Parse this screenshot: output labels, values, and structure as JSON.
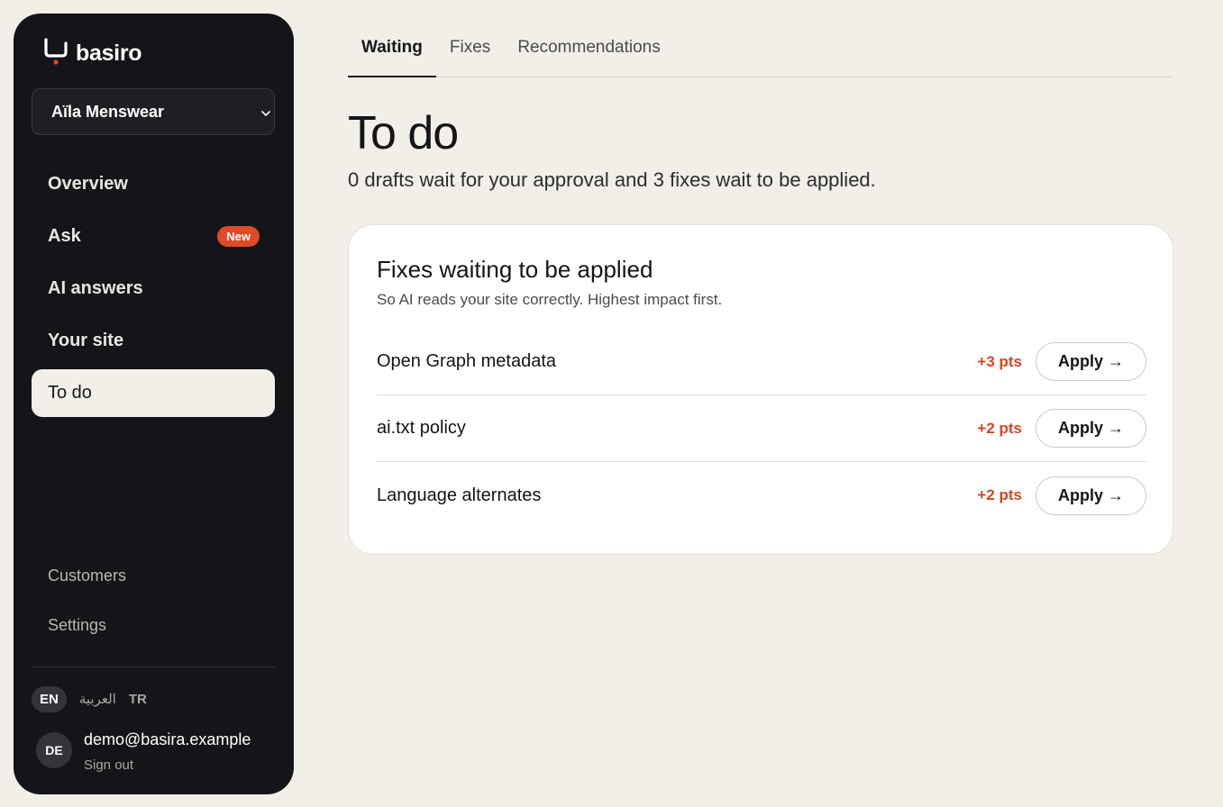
{
  "brand": {
    "name": "basiro",
    "accent": "#df4a27"
  },
  "workspace": {
    "selected": "Aïla Menswear",
    "icon": "chevron-down-icon"
  },
  "nav": {
    "items": [
      {
        "label": "Overview"
      },
      {
        "label": "Ask",
        "badge": "New"
      },
      {
        "label": "AI answers"
      },
      {
        "label": "Your site"
      },
      {
        "label": "To do",
        "active": true
      }
    ],
    "secondary": [
      {
        "label": "Customers"
      },
      {
        "label": "Settings"
      }
    ]
  },
  "languages": [
    {
      "label": "EN",
      "active": true
    },
    {
      "label": "العربية"
    },
    {
      "label": "TR"
    }
  ],
  "account": {
    "initials": "DE",
    "email": "demo@basira.example",
    "signout": "Sign out"
  },
  "tabs": [
    {
      "label": "Waiting",
      "active": true
    },
    {
      "label": "Fixes"
    },
    {
      "label": "Recommendations"
    }
  ],
  "page": {
    "title": "To do",
    "subtitle": "0 drafts wait for your approval and 3 fixes wait to be applied."
  },
  "card": {
    "title": "Fixes waiting to be applied",
    "subtitle": "So AI reads your site correctly. Highest impact first.",
    "fixes": [
      {
        "name": "Open Graph metadata",
        "points": "+3 pts",
        "action": "Apply →"
      },
      {
        "name": "ai.txt policy",
        "points": "+2 pts",
        "action": "Apply →"
      },
      {
        "name": "Language alternates",
        "points": "+2 pts",
        "action": "Apply →"
      }
    ]
  }
}
